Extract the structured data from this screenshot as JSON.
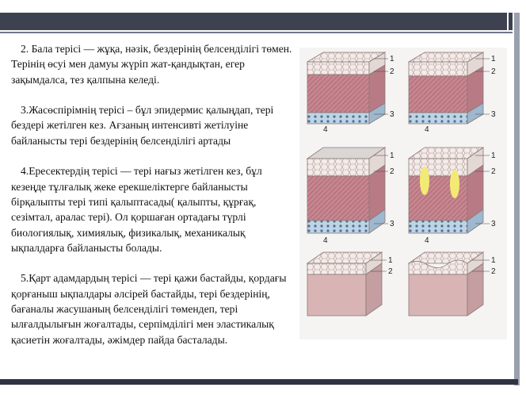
{
  "paragraphs": [
    "2. Бала терісі — жұқа, нәзік, бездерінің белсенділігі төмен. Терінің өсуі мен дамуы жүріп жат-қандықтан, егер зақымдалса, тез қалпына келеді.",
    "3.Жасөспірімнің терісі – бұл эпидермис қалыңдап, тері бездері жетілген кез. Ағзаның интенсивті жетілуіне байланысты тері бездерінің белсенділігі артады",
    "4.Ересектердің терісі — тері нағыз жетілген кез, бұл кезеңде тұлғалық жеке ерекшеліктерге байланысты бірқалыпты тері типі қалыптасады( қалыпты, құрғақ, сезімтал, аралас тері). Ол қоршаған ортадағы түрлі биологиялық, химиялық, физикалық, механикалық ықпалдарға байланысты болады.",
    "5.Қарт адамдардың терісі — тері қажи бастайды, қордағы қорғаныш ықпалдары әлсірей бастайды, тері бездерінің, бағаналы жасушаның белсенділігі төмендеп, тері ылғалдылығын жоғалтады, серпімділігі мен эластикалық қасиетін жоғалтады, әжімдер пайда басталады."
  ],
  "figure": {
    "layer_labels_top": [
      "1",
      "2",
      "3",
      "4"
    ],
    "layer_labels_middle": [
      "1",
      "2",
      "3",
      "4"
    ],
    "layer_labels_bottom": [
      "1",
      "2"
    ]
  },
  "colors": {
    "header": "#3d4150",
    "epidermis": "#f1e8e6",
    "dermis": "#c98f95",
    "hypodermis": "#b8d0e2"
  }
}
